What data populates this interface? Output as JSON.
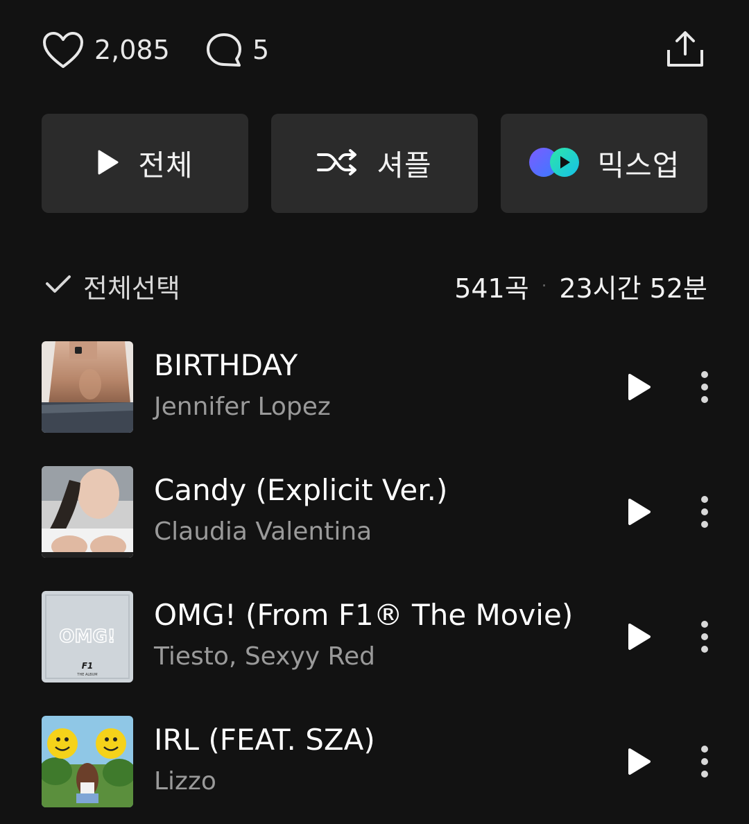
{
  "stats": {
    "likes": "2,085",
    "comments": "5"
  },
  "actions": {
    "play_all": "전체",
    "shuffle": "셔플",
    "mixup": "믹스업"
  },
  "selection": {
    "select_all": "전체선택",
    "track_count": "541곡",
    "separator": "·",
    "total_duration": "23시간 52분"
  },
  "tracks": [
    {
      "title": "BIRTHDAY",
      "artist": "Jennifer Lopez"
    },
    {
      "title": "Candy (Explicit Ver.)",
      "artist": "Claudia Valentina"
    },
    {
      "title": "OMG! (From F1® The Movie)",
      "artist": "Tiesto, Sexyy Red"
    },
    {
      "title": "IRL (FEAT. SZA)",
      "artist": "Lizzo"
    }
  ],
  "album_art_text": {
    "omg": "OMG!",
    "f1": "F1",
    "the_album": "THE ALBUM"
  },
  "colors": {
    "background": "#121212",
    "button_bg": "#2b2b2b",
    "primary_text": "#ffffff",
    "secondary_text": "#9a9a9a"
  }
}
